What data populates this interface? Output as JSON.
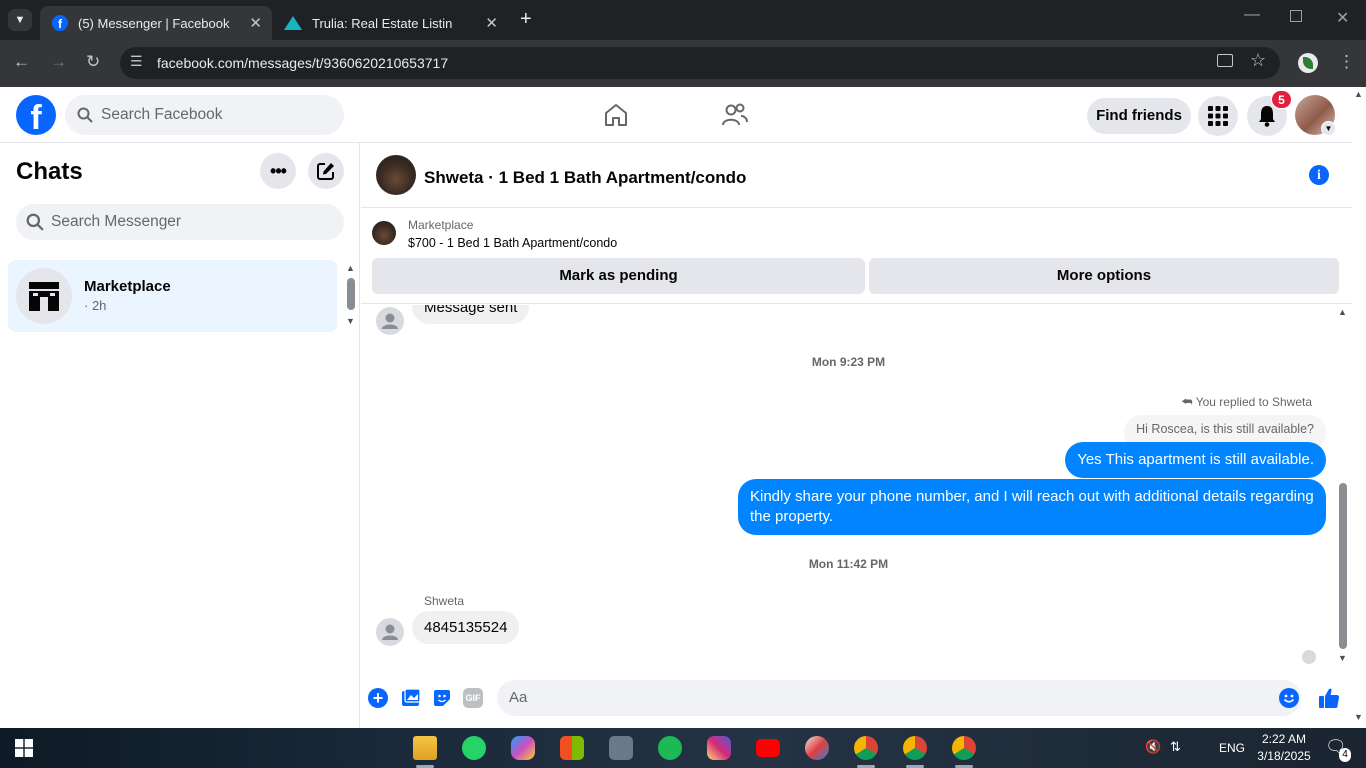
{
  "browser": {
    "tabs": [
      {
        "title": "(5) Messenger | Facebook",
        "active": true
      },
      {
        "title": "Trulia: Real Estate Listings, Hom",
        "active": false
      }
    ],
    "url": "facebook.com/messages/t/9360620210653717"
  },
  "header": {
    "search_placeholder": "Search Facebook",
    "find_friends_label": "Find friends",
    "notification_count": "5"
  },
  "sidebar": {
    "title": "Chats",
    "search_placeholder": "Search Messenger",
    "chats": [
      {
        "name": "Marketplace",
        "meta": "· 2h"
      }
    ]
  },
  "conversation": {
    "title": "Shweta · 1 Bed 1 Bath Apartment/condo",
    "listing": {
      "source": "Marketplace",
      "summary": "$700 - 1 Bed 1 Bath Apartment/condo"
    },
    "actions": {
      "mark_pending": "Mark as pending",
      "more_options": "More options"
    },
    "messages": {
      "sent_notice": "Message sent",
      "timestamp_1": "Mon 9:23 PM",
      "reply_context": "You replied to Shweta",
      "quoted": "Hi Roscea, is this still available?",
      "out_1": "Yes This apartment is still available.",
      "out_2": "Kindly share your phone number, and I will reach out with additional details regarding the property.",
      "timestamp_2": "Mon 11:42 PM",
      "sender_name": "Shweta",
      "in_1": "4845135524"
    },
    "composer_placeholder": "Aa"
  },
  "taskbar": {
    "language": "ENG",
    "time": "2:22 AM",
    "date": "3/18/2025",
    "notification_count": "4"
  },
  "colors": {
    "facebook_blue": "#0866ff",
    "messenger_blue": "#0084ff",
    "badge_red": "#e41e3f"
  }
}
